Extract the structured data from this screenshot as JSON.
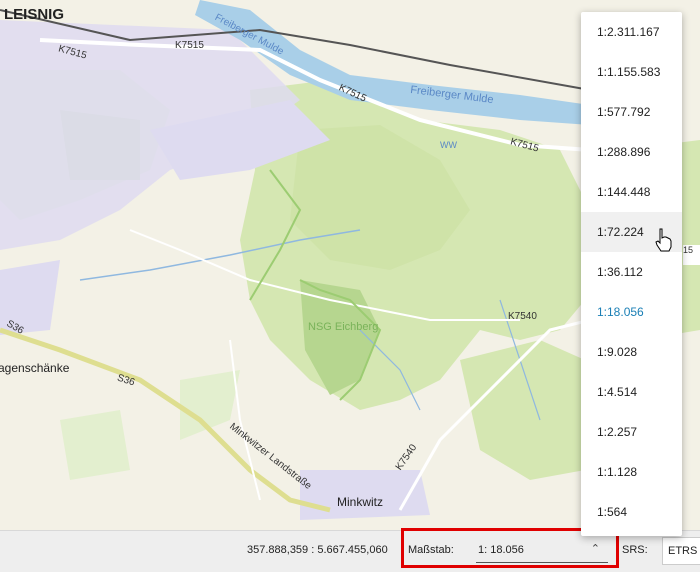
{
  "map": {
    "labels": {
      "town": "LEISNIG",
      "village": "Minkwitz",
      "place_left": "agenschänke",
      "nature_reserve": "NSG Eichberg",
      "river_upper": "Freiberger Mulde",
      "river_lower": "Freiberger Mulde",
      "ww": "WW",
      "roads": [
        "K7515",
        "K7515",
        "K7515",
        "K7515",
        "K7540",
        "K7540",
        "S36",
        "S36",
        "Minkwitzer Landstraße"
      ]
    },
    "colors": {
      "background": "#f3f1e6",
      "forest": "#d5e7b2",
      "forest_dark": "#b6d68f",
      "urban": "#dedbf0",
      "water": "#a9cfe8",
      "main_road": "#e6e69a",
      "stream": "#8fb8e0"
    }
  },
  "status": {
    "coordinates": "357.888,359 : 5.667.455,060",
    "scale_label": "Maßstab:",
    "scale_value": "1: 18.056",
    "srs_label": "SRS:",
    "srs_value": "ETRS"
  },
  "scale_dropdown": {
    "options": [
      "1:2.311.167",
      "1:1.155.583",
      "1:577.792",
      "1:288.896",
      "1:144.448",
      "1:72.224",
      "1:36.112",
      "1:18.056",
      "1:9.028",
      "1:4.514",
      "1:2.257",
      "1:1.128",
      "1:564"
    ],
    "selected": "1:18.056",
    "hovered": "1:72.224",
    "accent_color": "#1a7fb5"
  },
  "edge_text": "15"
}
